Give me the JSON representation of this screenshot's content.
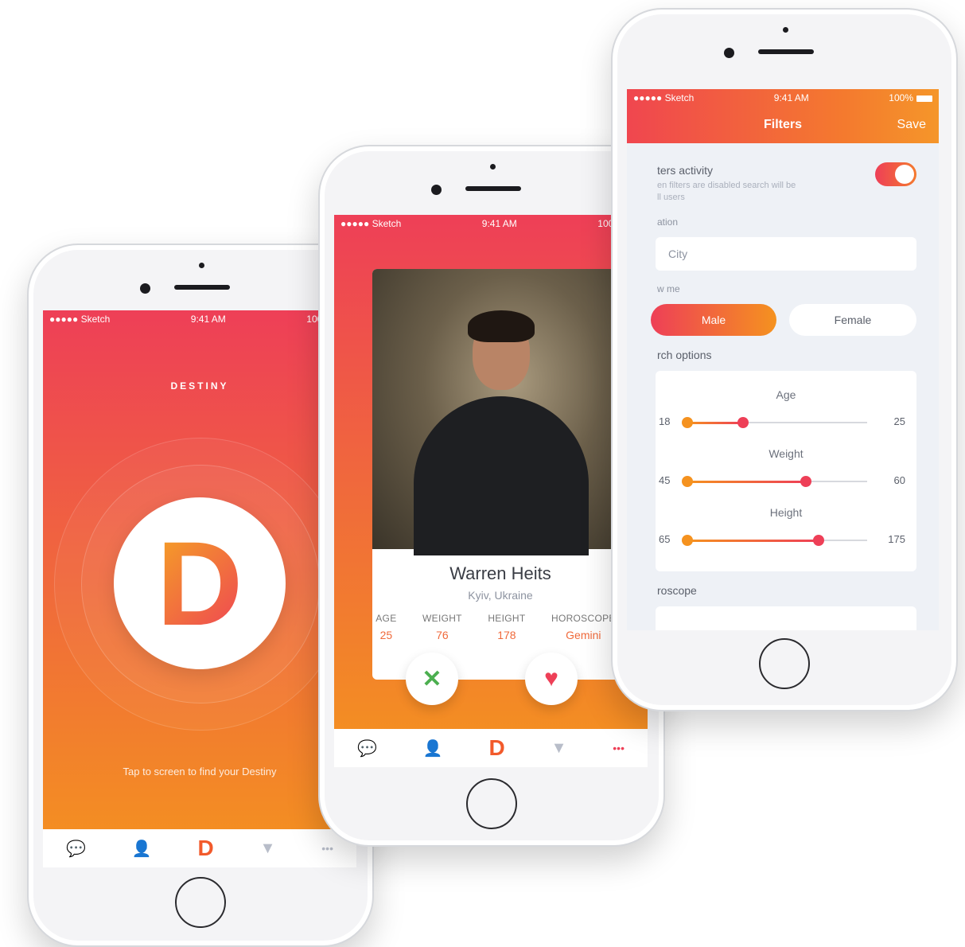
{
  "status_bar": {
    "carrier": "●●●●● Sketch",
    "wifi_icon": "wifi-icon",
    "time": "9:41 AM",
    "battery": "100%"
  },
  "splash": {
    "brand": "DESTINY",
    "logo_letter": "D",
    "tap_hint": "Tap to screen to find your Destiny"
  },
  "tabbar": {
    "items": [
      "chat-icon",
      "profile-icon",
      "destiny-icon",
      "filter-icon",
      "more-icon"
    ],
    "logo_letter": "D",
    "more_glyph": "•••"
  },
  "profile": {
    "name": "Warren Heits",
    "location": "Kyiv, Ukraine",
    "stats": [
      {
        "label": "AGE",
        "value": "25"
      },
      {
        "label": "WEIGHT",
        "value": "76"
      },
      {
        "label": "HEIGHT",
        "value": "178"
      },
      {
        "label": "HOROSCOPE",
        "value": "Gemini"
      }
    ],
    "dislike_glyph": "✕",
    "like_glyph": "♥"
  },
  "filters": {
    "title": "Filters",
    "save": "Save",
    "activity_title": "ters activity",
    "activity_desc_line1": "en filters are disabled search will be",
    "activity_desc_line2": "ll users",
    "toggle_on": true,
    "location_label": "ation",
    "city_placeholder": "City",
    "show_me_label": "w me",
    "gender_options": [
      "Male",
      "Female"
    ],
    "gender_selected": "Male",
    "search_options_label": "rch options",
    "sliders": [
      {
        "label": "Age",
        "min_label": "18",
        "max_label": "25",
        "low": 0.0,
        "high": 0.31
      },
      {
        "label": "Weight",
        "min_label": "45",
        "max_label": "60",
        "low": 0.0,
        "high": 0.66
      },
      {
        "label": "Height",
        "min_label": "65",
        "max_label": "175",
        "low": 0.0,
        "high": 0.73
      }
    ],
    "horoscope_label": "roscope"
  },
  "colors": {
    "accent_orange": "#f5921f",
    "accent_red": "#ee3f57",
    "like_pink": "#ee3f57",
    "dislike_green": "#4caf50",
    "bg_light": "#eef1f6"
  }
}
